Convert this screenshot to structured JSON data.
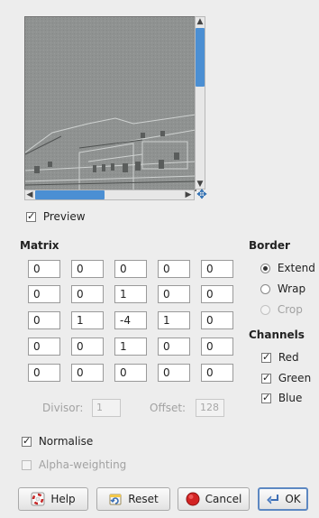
{
  "preview": {
    "label": "Preview",
    "checked": true
  },
  "matrix": {
    "title": "Matrix",
    "values": [
      [
        "0",
        "0",
        "0",
        "0",
        "0"
      ],
      [
        "0",
        "0",
        "1",
        "0",
        "0"
      ],
      [
        "0",
        "1",
        "-4",
        "1",
        "0"
      ],
      [
        "0",
        "0",
        "1",
        "0",
        "0"
      ],
      [
        "0",
        "0",
        "0",
        "0",
        "0"
      ]
    ],
    "divisor_label": "Divisor:",
    "divisor_value": "1",
    "offset_label": "Offset:",
    "offset_value": "128"
  },
  "border": {
    "title": "Border",
    "options": [
      {
        "label": "Extend",
        "selected": true,
        "enabled": true
      },
      {
        "label": "Wrap",
        "selected": false,
        "enabled": true
      },
      {
        "label": "Crop",
        "selected": false,
        "enabled": false
      }
    ]
  },
  "channels": {
    "title": "Channels",
    "items": [
      {
        "label": "Red",
        "checked": true
      },
      {
        "label": "Green",
        "checked": true
      },
      {
        "label": "Blue",
        "checked": true
      }
    ]
  },
  "normalise": {
    "label": "Normalise",
    "checked": true
  },
  "alpha_weighting": {
    "label": "Alpha-weighting",
    "checked": false,
    "enabled": false
  },
  "buttons": {
    "help": "Help",
    "reset": "Reset",
    "cancel": "Cancel",
    "ok": "OK"
  },
  "icons": {
    "help": "help-lifebuoy-icon",
    "reset": "reset-icon",
    "cancel": "cancel-icon",
    "ok": "ok-icon",
    "navigate": "navigate-move-icon"
  },
  "colors": {
    "scroll_thumb": "#4b8fd3",
    "default_border": "#5d88c2"
  }
}
